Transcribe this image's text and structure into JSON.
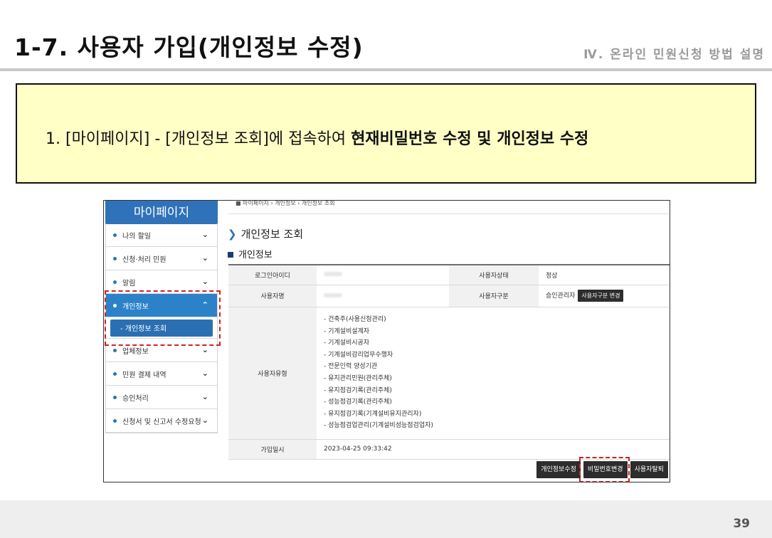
{
  "slide": {
    "title": "1-7. 사용자 가입(개인정보 수정)",
    "section": "Ⅳ. 온라인 민원신청 방법 설명",
    "callout_prefix": "1. [마이페이지] - [개인정보 조회]에 접속하여 ",
    "callout_bold": "현재비밀번호 수정 및 개인정보 수정",
    "page_number": "39"
  },
  "sidebar": {
    "header": "마이페이지",
    "items": [
      {
        "label": "나의 할일",
        "chevron": "⌄"
      },
      {
        "label": "신청·처리 민원",
        "chevron": "⌄"
      },
      {
        "label": "알림",
        "chevron": "⌄"
      },
      {
        "label": "개인정보",
        "chevron": "⌃"
      },
      {
        "label": "업체정보",
        "chevron": "⌄"
      },
      {
        "label": "민원 결제 내역",
        "chevron": "⌄"
      },
      {
        "label": "승인처리",
        "chevron": "⌄"
      },
      {
        "label": "신청서 및 신고서 수정요청",
        "chevron": "⌄"
      }
    ],
    "sub_item": "- 개인정보 조회"
  },
  "main": {
    "breadcrumb": "마이페이지 › 개인정보 › 개인정보 조회",
    "page_title": "개인정보 조회",
    "section_title": "개인정보",
    "labels": {
      "login_id": "로그인아이디",
      "user_status": "사용자상태",
      "user_name": "사용자명",
      "user_class": "사용자구분",
      "user_type": "사용자유형",
      "joined": "가입일시"
    },
    "values": {
      "user_status": "정상",
      "user_class": "승인관리자",
      "joined": "2023-04-25 09:33:42"
    },
    "change_class_button": "사용자구분 변경",
    "user_types": [
      "- 건축주(사용신청관리)",
      "- 기계설비설계자",
      "- 기계설비시공자",
      "- 기계설비감리업무수행자",
      "- 전문인력 양성기관",
      "- 유지관리민원(관리주체)",
      "- 유지점검기록(관리주체)",
      "- 성능점검기록(관리주체)",
      "- 유지점검기록(기계설비유지관리자)",
      "- 성능점검업관리(기계설비성능점검업자)"
    ],
    "buttons": {
      "edit_info": "개인정보수정",
      "change_password": "비밀번호변경",
      "withdraw": "사용자탈퇴"
    }
  },
  "colors": {
    "callout_bg": "#ffffc6",
    "sidebar_blue": "#2f72b9",
    "highlight_red": "#d32020"
  }
}
